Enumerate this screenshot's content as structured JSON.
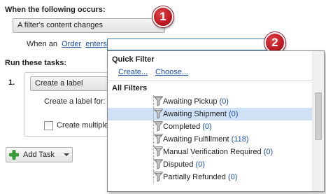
{
  "trigger": {
    "heading": "When the following occurs:",
    "selected_event": "A filter's content changes",
    "when_prefix": "When an",
    "object_link": "Order",
    "action_link": "enters"
  },
  "callouts": {
    "first": "1",
    "second": "2"
  },
  "tasks": {
    "heading": "Run these tasks:",
    "step_number": "1.",
    "task_type": "Create a label",
    "create_label_for": "Create a label for:",
    "create_multiple": "Create multiple",
    "add_task_label": "Add Task"
  },
  "popup": {
    "quick_filter_heading": "Quick Filter",
    "create_link": "Create...",
    "choose_link": "Choose...",
    "all_filters_heading": "All Filters",
    "items": [
      {
        "label": "Awaiting Pickup",
        "count": "(0)",
        "selected": false
      },
      {
        "label": "Awaiting Shipment",
        "count": "(0)",
        "selected": true
      },
      {
        "label": "Completed",
        "count": "(0)",
        "selected": false
      },
      {
        "label": "Awaiting Fulfillment",
        "count": "(118)",
        "selected": false
      },
      {
        "label": "Manual Verification Required",
        "count": "(0)",
        "selected": false
      },
      {
        "label": "Disputed",
        "count": "(0)",
        "selected": false
      },
      {
        "label": "Partially Refunded",
        "count": "(0)",
        "selected": false
      }
    ],
    "scroll_fraction": 0.45
  },
  "colors": {
    "link": "#1c4fa8",
    "selection": "#cfe1f5",
    "badge": "#c4161f",
    "add_icon": "#3aa635"
  }
}
